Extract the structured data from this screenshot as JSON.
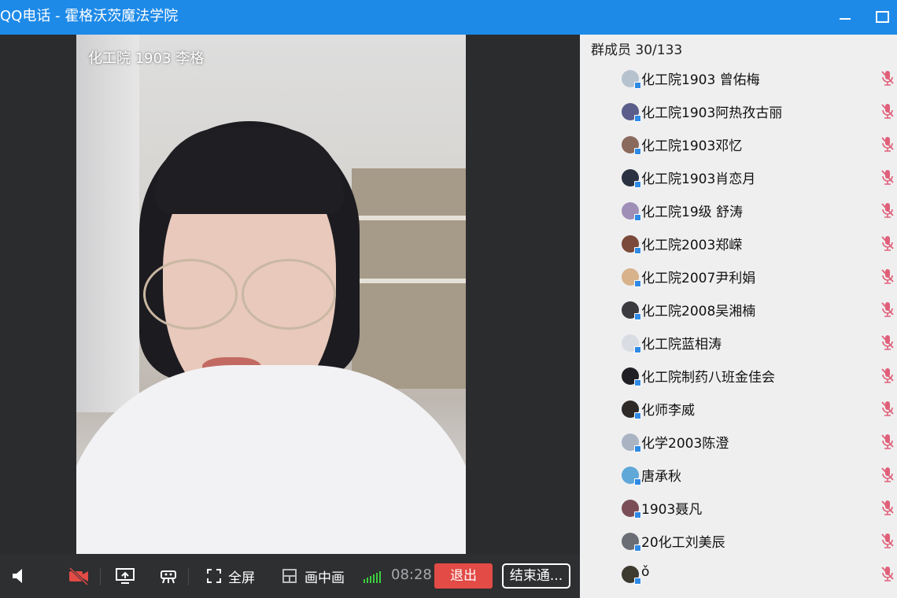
{
  "window": {
    "title": "QQ电话 - 霍格沃茨魔法学院"
  },
  "video": {
    "participant_name": "化工院 1903 李格"
  },
  "toolbar": {
    "fullscreen_label": "全屏",
    "pip_label": "画中画",
    "timer": "08:28",
    "exit_label": "退出",
    "end_label": "结束通..."
  },
  "panel": {
    "header": "群成员 30/133",
    "members": [
      {
        "name": "化工院1903 曾佑梅",
        "avatar_color": "#b7c2cf"
      },
      {
        "name": "化工院1903阿热孜古丽",
        "avatar_color": "#5b5e8a"
      },
      {
        "name": "化工院1903邓忆",
        "avatar_color": "#8a6a5c"
      },
      {
        "name": "化工院1903肖恋月",
        "avatar_color": "#2a3140"
      },
      {
        "name": "化工院19级 舒涛",
        "avatar_color": "#9f8fb7"
      },
      {
        "name": "化工院2003郑嵘",
        "avatar_color": "#7b4a3a"
      },
      {
        "name": "化工院2007尹利娟",
        "avatar_color": "#d7b28a"
      },
      {
        "name": "化工院2008吴湘楠",
        "avatar_color": "#3a3a3f"
      },
      {
        "name": "化工院蓝相涛",
        "avatar_color": "#d9dde3"
      },
      {
        "name": "化工院制药八班金佳会",
        "avatar_color": "#1f1f24"
      },
      {
        "name": "化师李威",
        "avatar_color": "#2e2a28"
      },
      {
        "name": "化学2003陈澄",
        "avatar_color": "#a9b3c2"
      },
      {
        "name": "唐承秋",
        "avatar_color": "#5fa8d8"
      },
      {
        "name": "1903聂凡",
        "avatar_color": "#7a4d57"
      },
      {
        "name": "20化工刘美辰",
        "avatar_color": "#6b6f75"
      },
      {
        "name": "ǒ",
        "avatar_color": "#3d3a2f"
      }
    ],
    "member_mic_state": "muted"
  },
  "colors": {
    "title_bar": "#1e8ae8",
    "exit_button": "#e24b46",
    "mic_muted": "#e0607a",
    "signal": "#3ccf3c"
  },
  "icons": [
    "speaker-icon",
    "camera-off-icon",
    "screen-share-icon",
    "gift-icon",
    "fullscreen-icon",
    "picture-in-picture-icon",
    "signal-icon",
    "mic-muted-icon"
  ]
}
